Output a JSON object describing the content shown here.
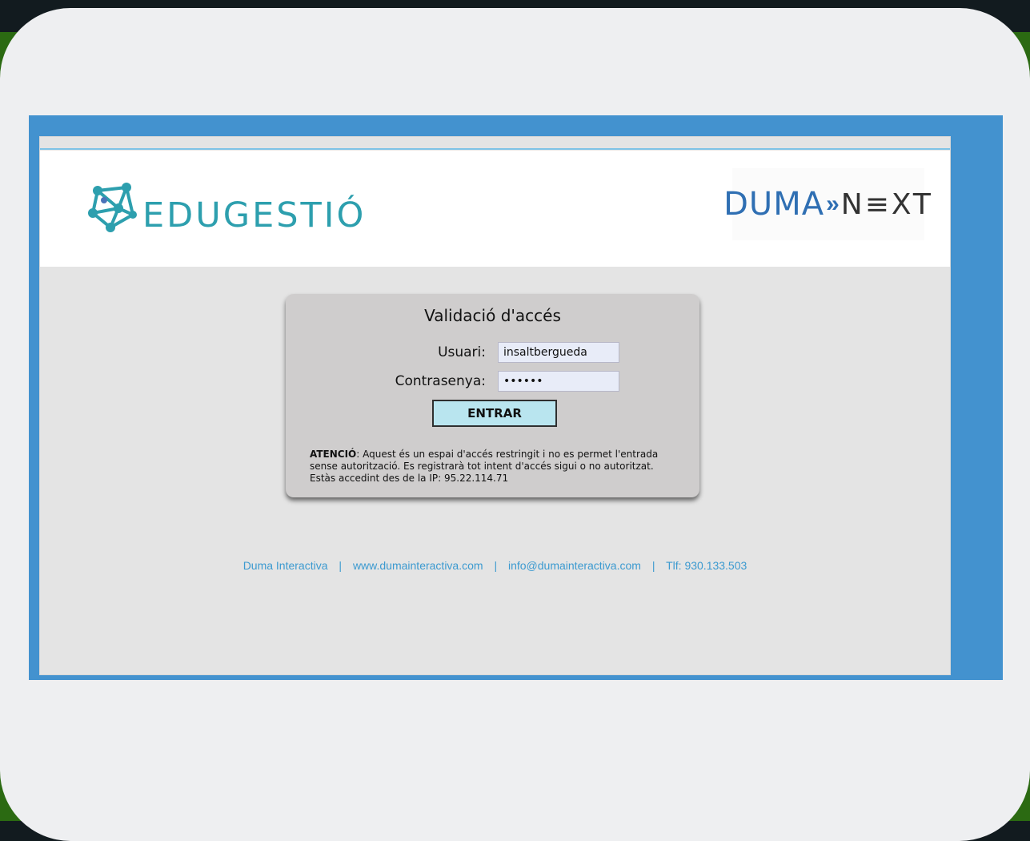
{
  "colors": {
    "background_dark": "#121b1f",
    "card": "#eeeff1",
    "frame_blue": "#4392cf",
    "edu_teal": "#2d9fae",
    "duma_blue": "#2f6fb3",
    "button_fill": "#b9e5ef",
    "footer_link": "#3c9ad0"
  },
  "header": {
    "edu_logo_text": "EDUGESTIÓ",
    "duma_brand": "DUMA",
    "duma_arrows": "»",
    "duma_next": "N≡XT"
  },
  "login": {
    "title": "Validació d'accés",
    "user_label": "Usuari:",
    "user_value": "insaltbergueda",
    "password_label": "Contrasenya:",
    "password_value": "••••••",
    "submit_label": "ENTRAR",
    "warning_bold": "ATENCIÓ",
    "warning_text": ": Aquest és un espai d'accés restringit i no es permet l'entrada sense autorització. Es registrarà tot intent d'accés sigui o no autoritzat.",
    "ip_line": "Estàs accedint des de la IP: 95.22.114.71"
  },
  "footer": {
    "company": "Duma Interactiva",
    "website": "www.dumainteractiva.com",
    "email": "info@dumainteractiva.com",
    "phone": "Tlf: 930.133.503",
    "separator": "|"
  }
}
